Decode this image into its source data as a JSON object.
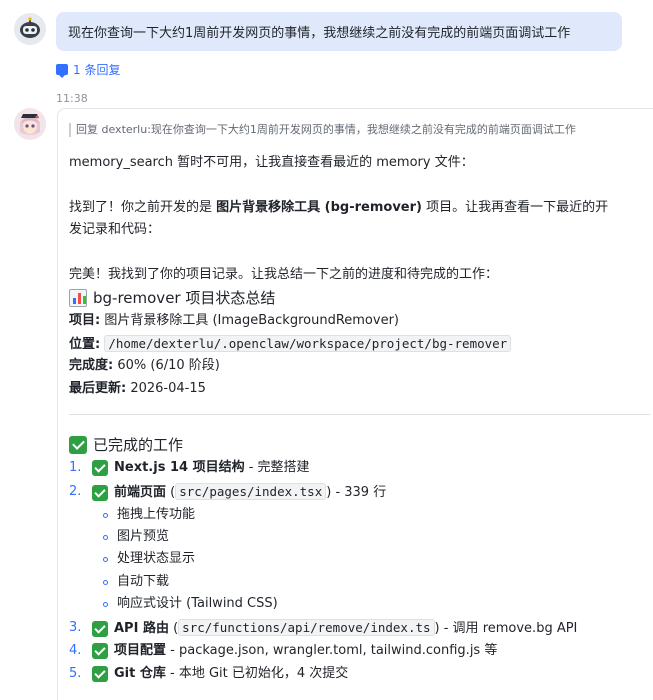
{
  "user_message": {
    "text": "现在你查询一下大约1周前开发网页的事情，我想继续之前没有完成的前端页面调试工作",
    "reply_count_label": "1 条回复"
  },
  "bot_message": {
    "timestamp": "11:38",
    "quote_prefix": "回复 dexterlu:",
    "quote_text": "现在你查询一下大约1周前开发网页的事情，我想继续之前没有完成的前端页面调试工作",
    "line1": "memory_search 暂时不可用，让我直接查看最近的 memory 文件：",
    "line2_a": "找到了！你之前开发的是 ",
    "line2_bold": "图片背景移除工具 (bg-remover)",
    "line2_b": " 项目。让我再查看一下最近的开",
    "line2_cont": "发记录和代码：",
    "line3": "完美！我找到了你的项目记录。让我总结一下之前的进度和待完成的工作：",
    "summary_title": "bg-remover 项目状态总结",
    "project_label": "项目:",
    "project_value": "图片背景移除工具 (ImageBackgroundRemover)",
    "location_label": "位置:",
    "location_value": "/home/dexterlu/.openclaw/workspace/project/bg-remover",
    "progress_label": "完成度:",
    "progress_value": "60% (6/10 阶段)",
    "updated_label": "最后更新:",
    "updated_value": "2026-04-15",
    "done_title": "已完成的工作",
    "done_items": [
      {
        "num": "1.",
        "bold": "Next.js 14 项目结构",
        "rest": " - 完整搭建"
      },
      {
        "num": "2.",
        "bold": "前端页面",
        "pre": " (",
        "code": "src/pages/index.tsx",
        "rest": ") - 339 行"
      },
      {
        "num": "3.",
        "bold": "API 路由",
        "pre": " (",
        "code": "src/functions/api/remove/index.ts",
        "rest": ") - 调用 remove.bg API"
      },
      {
        "num": "4.",
        "bold": "项目配置",
        "rest": " - package.json, wrangler.toml, tailwind.config.js 等"
      },
      {
        "num": "5.",
        "bold": "Git 仓库",
        "rest": " - 本地 Git 已初始化，4 次提交"
      }
    ],
    "sub_items": [
      "拖拽上传功能",
      "图片预览",
      "处理状态显示",
      "自动下载",
      "响应式设计 (Tailwind CSS)"
    ]
  }
}
